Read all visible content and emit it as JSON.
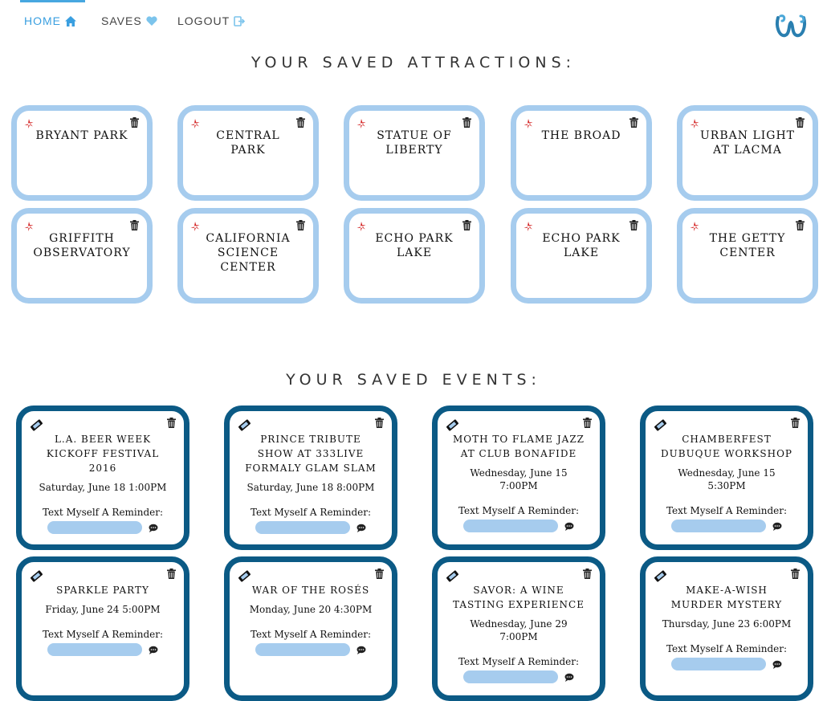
{
  "nav": {
    "items": [
      {
        "label": "HOME",
        "icon": "home-icon",
        "active": true
      },
      {
        "label": "SAVES",
        "icon": "heart-icon",
        "active": false
      },
      {
        "label": "LOGOUT",
        "icon": "logout-icon",
        "active": false
      }
    ],
    "logo": "w-logo"
  },
  "attractions": {
    "heading": "YOUR SAVED ATTRACTIONS:",
    "items": [
      {
        "name": "BRYANT PARK"
      },
      {
        "name": "CENTRAL PARK"
      },
      {
        "name": "STATUE OF LIBERTY"
      },
      {
        "name": "THE BROAD"
      },
      {
        "name": "URBAN LIGHT AT LACMA"
      },
      {
        "name": "GRIFFITH OBSERVATORY"
      },
      {
        "name": "CALIFORNIA SCIENCE CENTER"
      },
      {
        "name": "ECHO PARK LAKE"
      },
      {
        "name": "ECHO PARK LAKE"
      },
      {
        "name": "THE GETTY CENTER"
      }
    ]
  },
  "events": {
    "heading": "YOUR SAVED EVENTS:",
    "reminder_label": "Text Myself A Reminder:",
    "items": [
      {
        "title": "L.A. BEER WEEK KICKOFF FESTIVAL 2016",
        "date": "Saturday, June 18 1:00PM"
      },
      {
        "title": "PRINCE TRIBUTE SHOW AT 333LIVE FORMALY GLAM SLAM",
        "date": "Saturday, June 18 8:00PM"
      },
      {
        "title": "MOTH TO FLAME JAZZ AT CLUB BONAFIDE",
        "date": "Wednesday, June 15 7:00PM"
      },
      {
        "title": "CHAMBERFEST DUBUQUE WORKSHOP",
        "date": "Wednesday, June 15 5:30PM"
      },
      {
        "title": "SPARKLE PARTY",
        "date": "Friday, June 24 5:00PM"
      },
      {
        "title": "WAR OF THE ROSÉS",
        "date": "Monday, June 20 4:30PM"
      },
      {
        "title": "SAVOR: A WINE TASTING EXPERIENCE",
        "date": "Wednesday, June 29 7:00PM"
      },
      {
        "title": "MAKE-A-WISH MURDER MYSTERY",
        "date": "Thursday, June 23 6:00PM"
      }
    ]
  },
  "colors": {
    "nav_active": "#3a9fe0",
    "attraction_border": "#a6ccee",
    "event_border": "#0b5a85",
    "yelp_red": "#d32323"
  }
}
